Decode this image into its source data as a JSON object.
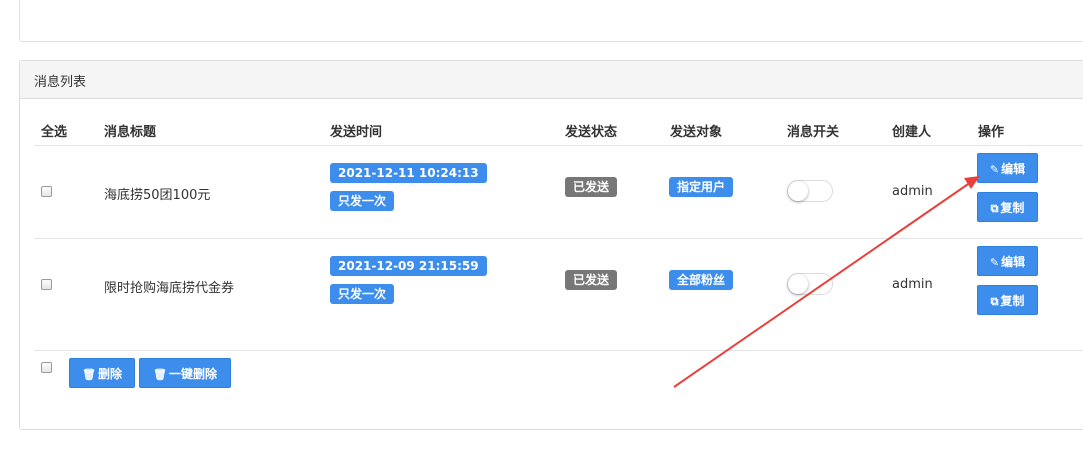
{
  "panel": {
    "title": "消息列表"
  },
  "table": {
    "headers": {
      "select_all": "全选",
      "title": "消息标题",
      "send_time": "发送时间",
      "send_status": "发送状态",
      "send_target": "发送对象",
      "switch": "消息开关",
      "creator": "创建人",
      "actions": "操作"
    },
    "rows": [
      {
        "title": "海底捞50团100元",
        "send_time": "2021-12-11 10:24:13",
        "frequency": "只发一次",
        "status": "已发送",
        "target": "指定用户",
        "switch_on": false,
        "creator": "admin",
        "edit_label": "编辑",
        "copy_label": "复制"
      },
      {
        "title": "限时抢购海底捞代金券",
        "send_time": "2021-12-09 21:15:59",
        "frequency": "只发一次",
        "status": "已发送",
        "target": "全部粉丝",
        "switch_on": false,
        "creator": "admin",
        "edit_label": "编辑",
        "copy_label": "复制"
      }
    ]
  },
  "footer": {
    "delete_label": "删除",
    "delete_all_label": "一键删除"
  },
  "icons": {
    "edit": "edit-icon",
    "copy": "copy-icon",
    "trash": "trash-icon"
  },
  "colors": {
    "primary": "#3c8dec",
    "status_gray": "#777777",
    "annotation_arrow": "#e8413a"
  }
}
